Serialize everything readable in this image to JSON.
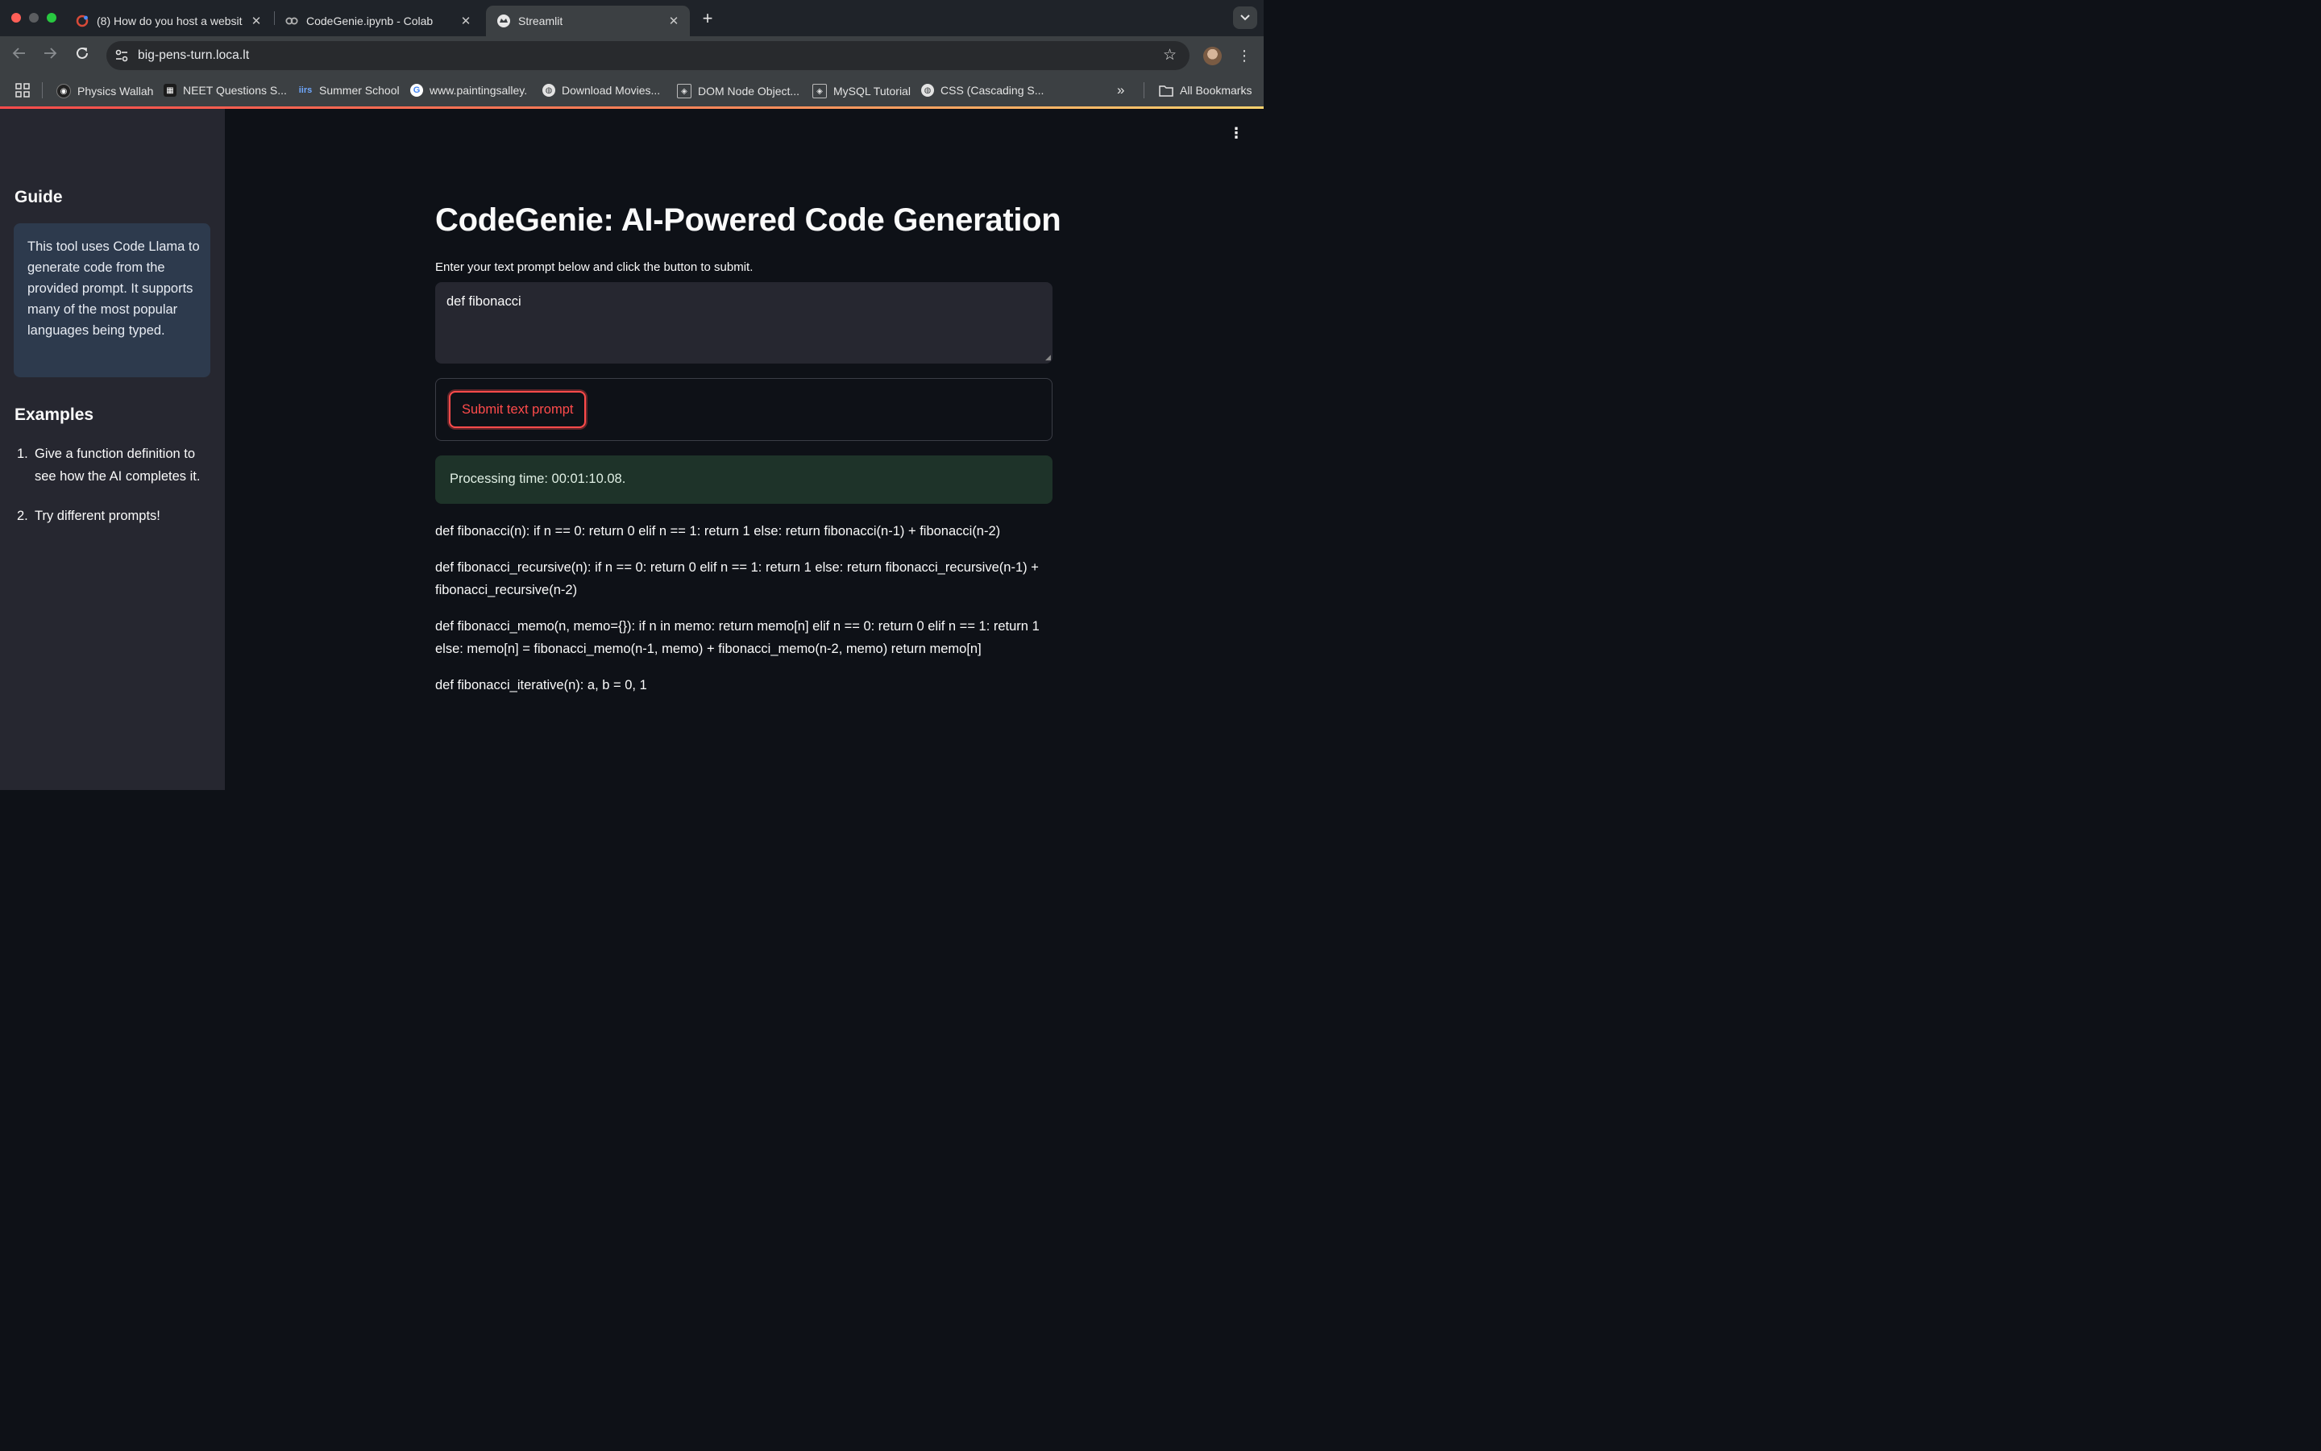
{
  "browser": {
    "tabs": [
      {
        "title": "(8) How do you host a websit",
        "icon": "quora-icon",
        "active": false
      },
      {
        "title": "CodeGenie.ipynb - Colab",
        "icon": "colab-icon",
        "active": false
      },
      {
        "title": "Streamlit",
        "icon": "streamlit-icon",
        "active": true
      }
    ],
    "url": "big-pens-turn.loca.lt",
    "bookmarks": [
      {
        "label": "Physics Wallah",
        "icon": "pw-icon"
      },
      {
        "label": "NEET Questions S...",
        "icon": "neet-icon"
      },
      {
        "label": "Summer School",
        "icon": "iirs-icon"
      },
      {
        "label": "www.paintingsalley.",
        "icon": "google-icon"
      },
      {
        "label": "Download Movies...",
        "icon": "globe-icon"
      },
      {
        "label": "DOM Node Object...",
        "icon": "w3-icon"
      },
      {
        "label": "MySQL Tutorial",
        "icon": "w3-icon"
      },
      {
        "label": "CSS (Cascading S...",
        "icon": "globe-icon"
      }
    ],
    "all_bookmarks_label": "All Bookmarks"
  },
  "sidebar": {
    "guide_heading": "Guide",
    "guide_text": "This tool uses Code Llama to generate code from the provided prompt. It supports many of the most popular languages being typed.",
    "examples_heading": "Examples",
    "examples": [
      {
        "num": "1.",
        "text": "Give a function definition to see how the AI completes it."
      },
      {
        "num": "2.",
        "text": "Try different prompts!"
      }
    ]
  },
  "main": {
    "title": "CodeGenie: AI-Powered Code Generation",
    "instructions": "Enter your text prompt below and click the button to submit.",
    "prompt_value": "def fibonacci",
    "submit_label": "Submit text prompt",
    "processing_time": "Processing time: 00:01:10.08.",
    "output_lines": [
      "def fibonacci(n): if n == 0: return 0 elif n == 1: return 1 else: return fibonacci(n-1) + fibonacci(n-2)",
      "def fibonacci_recursive(n): if n == 0: return 0 elif n == 1: return 1 else: return fibonacci_recursive(n-1) + fibonacci_recursive(n-2)",
      "def fibonacci_memo(n, memo={}): if n in memo: return memo[n] elif n == 0: return 0 elif n == 1: return 1 else: memo[n] = fibonacci_memo(n-1, memo) + fibonacci_memo(n-2, memo) return memo[n]",
      "def fibonacci_iterative(n): a, b = 0, 1"
    ]
  },
  "colors": {
    "accent": "#ff4b4b",
    "sidebar_bg": "#262730",
    "main_bg": "#0e1117",
    "info_bg": "#2d3a4d",
    "success_bg": "#1e3329"
  }
}
